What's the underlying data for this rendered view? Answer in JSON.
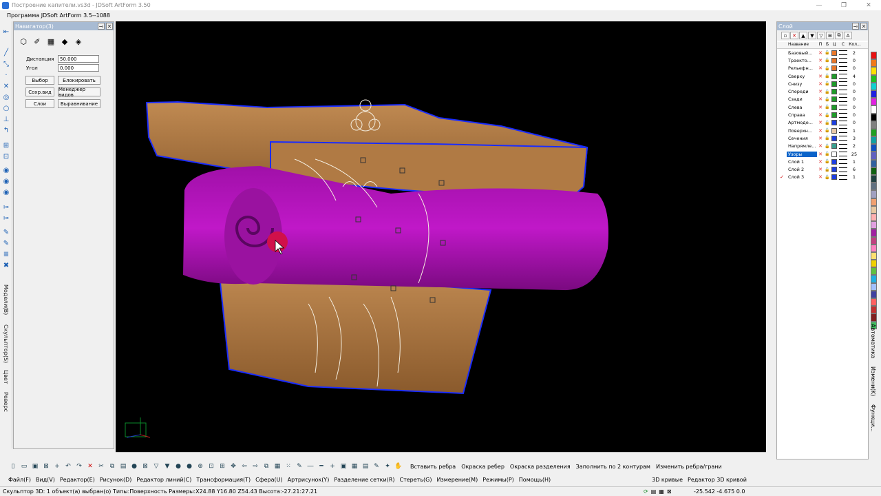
{
  "window": {
    "title": "Построение капители.vs3d - JDSoft ArtForm 3.50"
  },
  "menu": {
    "program": "Программа JDSoft ArtForm 3.5--1088"
  },
  "navigator": {
    "title": "Навигатор(3)",
    "distance_label": "Дистанция",
    "distance_value": "50.000",
    "angle_label": "Угол",
    "angle_value": "0.000",
    "buttons": [
      "Выбор",
      "Блокировать",
      "Сохр.вид",
      "Менеджер видов",
      "Слои",
      "Выравнивание"
    ]
  },
  "left_vtabs": [
    "Модели(B)",
    "Скульптор(S)",
    "Цвет",
    "Реверс"
  ],
  "layers": {
    "title": "Слой",
    "columns": [
      "Название",
      "П",
      "Б",
      "Ц",
      "С",
      "Кол..."
    ],
    "rows": [
      {
        "name": "Базовый...",
        "color": "#e8772a",
        "count": "2"
      },
      {
        "name": "Траекто...",
        "color": "#e8772a",
        "count": "0"
      },
      {
        "name": "Рельефн...",
        "color": "#e8772a",
        "count": "0"
      },
      {
        "name": "Сверху",
        "color": "#1f9b2a",
        "count": "4"
      },
      {
        "name": "Снизу",
        "color": "#1f9b2a",
        "count": "0"
      },
      {
        "name": "Спереди",
        "color": "#1f9b2a",
        "count": "0"
      },
      {
        "name": "Сзади",
        "color": "#1f9b2a",
        "count": "0"
      },
      {
        "name": "Слева",
        "color": "#1f9b2a",
        "count": "0"
      },
      {
        "name": "Справа",
        "color": "#1f9b2a",
        "count": "0"
      },
      {
        "name": "Артмоде...",
        "color": "#1e3fe0",
        "count": "0"
      },
      {
        "name": "Поверхн...",
        "color": "#e8c8a8",
        "count": "1"
      },
      {
        "name": "Сечения",
        "color": "#1e3fe0",
        "count": "3"
      },
      {
        "name": "Напрямле...",
        "color": "#3a9f8f",
        "count": "2"
      },
      {
        "name": "Узоры",
        "color": "#ffffff",
        "count": "25",
        "selected": true
      },
      {
        "name": "Слой 1",
        "color": "#1e3fe0",
        "count": "1"
      },
      {
        "name": "Слой 2",
        "color": "#1e3fe0",
        "count": "6"
      },
      {
        "name": "Слой 3",
        "color": "#1e3fe0",
        "count": "1",
        "current": true
      }
    ]
  },
  "palette": [
    "#e81010",
    "#f07818",
    "#ffe000",
    "#20c020",
    "#10d0d0",
    "#2020e0",
    "#e020e0",
    "#ffffff",
    "#000000",
    "#808080",
    "#20a020",
    "#10a0a0",
    "#1050c0",
    "#6060c0",
    "#3060a0",
    "#106010",
    "#204040",
    "#607080",
    "#a0a0c0",
    "#f0a070",
    "#e8c8a0",
    "#ffb0b0",
    "#e0a0e0",
    "#a020a0",
    "#c04080",
    "#ff80c0",
    "#ffe070",
    "#f0d000",
    "#60c040",
    "#20b0e0",
    "#a0c0ff",
    "#4040a0",
    "#ff6060",
    "#c03030",
    "#802020",
    "#40c060"
  ],
  "right_vtabs": [
    "Автоматика",
    "Измени(K)",
    "Функци..."
  ],
  "bottom_toolbar": {
    "commands": [
      "Вставить ребра",
      "Окраска ребер",
      "Окраска разделения",
      "Заполнить по 2 контурам",
      "Изменить ребра/грани"
    ]
  },
  "bottom_menu": [
    "Файл(F)",
    "Вид(V)",
    "Редактор(E)",
    "Рисунок(D)",
    "Редактор линий(C)",
    "Трансформация(T)",
    "Сфера(U)",
    "Артрисунок(Y)",
    "Разделение сетки(R)",
    "Стереть(G)",
    "Измерение(M)",
    "Режимы(P)",
    "Помощь(H)",
    "3D кривые",
    "Редактор 3D кривой"
  ],
  "status": {
    "text": "Скульптор 3D: 1 объект(а) выбран(о) Типы:Поверхность  Размеры:X24.88 Y16.80 Z54.43 Высота:-27.21:27.21",
    "coords": "-25.542 -4.675 0.0"
  }
}
